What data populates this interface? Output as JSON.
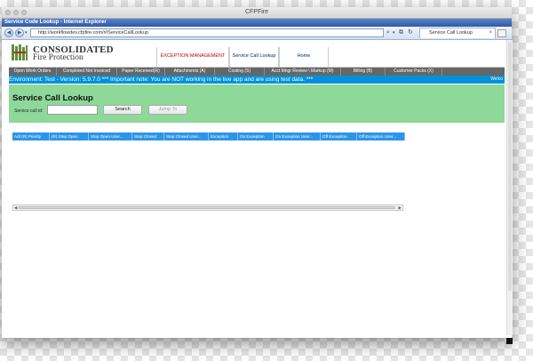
{
  "mac_window": {
    "title": "CFPFire"
  },
  "ie_window": {
    "title": "Service Code Lookup - Internet Explorer"
  },
  "address_bar": {
    "url": "http://workflowdev.cfpfire.com/#/ServiceCallLookup"
  },
  "browser_tab": {
    "label": "Service Call Lookup",
    "close": "×"
  },
  "app_header": {
    "logo_title": "CONSOLIDATED",
    "logo_subtitle": "Fire Protection",
    "links": [
      {
        "label": "EXCEPTION MANAGEMENT",
        "color": "#c00000"
      },
      {
        "label": "Service Call Lookup",
        "color": "#00247d"
      },
      {
        "label": "Home",
        "color": "#00247d"
      }
    ]
  },
  "menu": [
    "Open Work Orders",
    "Completed Not Invoiced",
    "Paper Received(R)",
    "Attachments (A)",
    "Costing (S)",
    "Acct Mngr Review \\ Markup (M)",
    "Billing (B)",
    "Customer Packs (X)"
  ],
  "environment_bar": {
    "text": "Environment: Test - Version: 5.9.7.0 *** Important note: You are NOT working in the live app and are using test data. ***",
    "right_text": "Welco"
  },
  "lookup_panel": {
    "title": "Service Call Lookup",
    "input_label": "Service call id:",
    "input_value": "",
    "search_button": "Search",
    "jump_button": "Jump To"
  },
  "queue_tabs": [
    "Adt (R) Priority",
    "(R) Step Open",
    "Step Open User...",
    "Step Closed",
    "Step Closed User...",
    "Exception",
    "On Exception",
    "On Exception User...",
    "Off Exception",
    "Off Exception User..."
  ],
  "colors": {
    "menu_bg": "#666666",
    "environment_bg": "#0091d9",
    "panel_bg": "#8ed89a",
    "tab_bg": "#2d95e8"
  }
}
